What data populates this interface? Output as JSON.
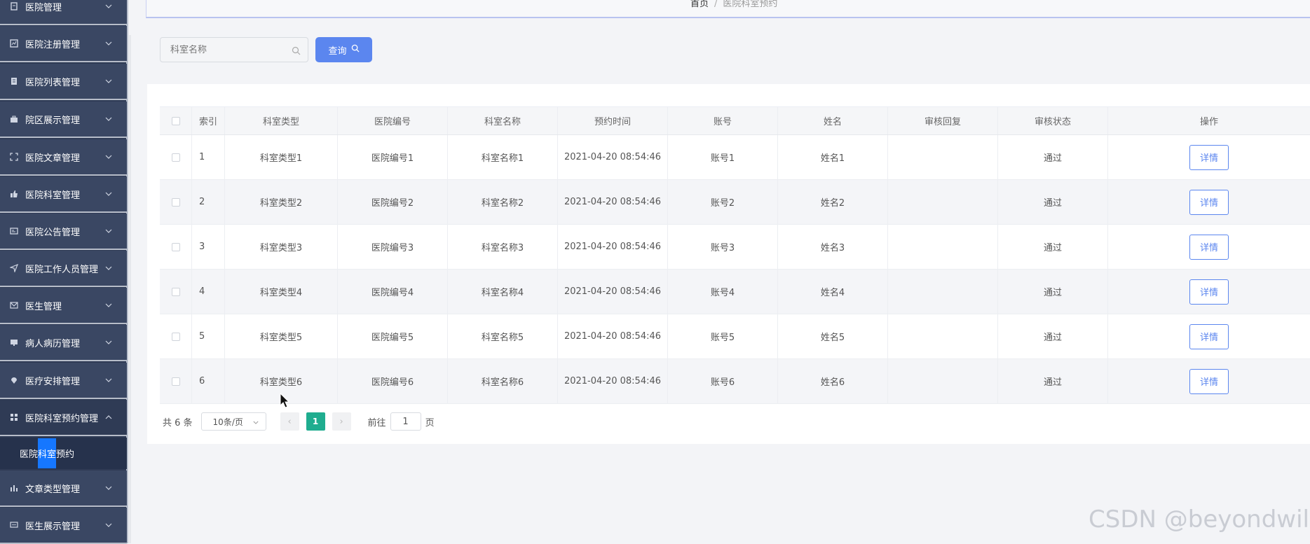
{
  "sidebar": {
    "items": [
      {
        "label": "医院管理",
        "icon": "badge-icon"
      },
      {
        "label": "医院注册管理",
        "icon": "chart-icon"
      },
      {
        "label": "医院列表管理",
        "icon": "clipboard-icon"
      },
      {
        "label": "院区展示管理",
        "icon": "briefcase-icon"
      },
      {
        "label": "医院文章管理",
        "icon": "fullscreen-icon"
      },
      {
        "label": "医院科室管理",
        "icon": "thumb-icon"
      },
      {
        "label": "医院公告管理",
        "icon": "notice-icon"
      },
      {
        "label": "医院工作人员管理",
        "icon": "send-icon"
      },
      {
        "label": "医生管理",
        "icon": "mail-icon"
      },
      {
        "label": "病人病历管理",
        "icon": "monitor-icon"
      },
      {
        "label": "医疗安排管理",
        "icon": "location-icon"
      },
      {
        "label": "医院科室预约管理",
        "icon": "grid-icon"
      },
      {
        "label": "文章类型管理",
        "icon": "bar-chart-icon"
      },
      {
        "label": "医生展示管理",
        "icon": "chat-icon"
      }
    ],
    "submenu": {
      "label": "医院科室预约"
    }
  },
  "breadcrumb": {
    "home": "首页",
    "sep": "/",
    "current": "医院科室预约"
  },
  "search": {
    "placeholder": "科室名称",
    "button": "查询"
  },
  "table": {
    "headers": [
      "索引",
      "科室类型",
      "医院编号",
      "科室名称",
      "预约时间",
      "账号",
      "姓名",
      "审核回复",
      "审核状态",
      "操作"
    ],
    "rows": [
      {
        "idx": "1",
        "type": "科室类型1",
        "hospital_no": "医院编号1",
        "dept": "科室名称1",
        "time": "2021-04-20 08:54:46",
        "account": "账号1",
        "name": "姓名1",
        "reply": "",
        "status": "通过",
        "action": "详情"
      },
      {
        "idx": "2",
        "type": "科室类型2",
        "hospital_no": "医院编号2",
        "dept": "科室名称2",
        "time": "2021-04-20 08:54:46",
        "account": "账号2",
        "name": "姓名2",
        "reply": "",
        "status": "通过",
        "action": "详情"
      },
      {
        "idx": "3",
        "type": "科室类型3",
        "hospital_no": "医院编号3",
        "dept": "科室名称3",
        "time": "2021-04-20 08:54:46",
        "account": "账号3",
        "name": "姓名3",
        "reply": "",
        "status": "通过",
        "action": "详情"
      },
      {
        "idx": "4",
        "type": "科室类型4",
        "hospital_no": "医院编号4",
        "dept": "科室名称4",
        "time": "2021-04-20 08:54:46",
        "account": "账号4",
        "name": "姓名4",
        "reply": "",
        "status": "通过",
        "action": "详情"
      },
      {
        "idx": "5",
        "type": "科室类型5",
        "hospital_no": "医院编号5",
        "dept": "科室名称5",
        "time": "2021-04-20 08:54:46",
        "account": "账号5",
        "name": "姓名5",
        "reply": "",
        "status": "通过",
        "action": "详情"
      },
      {
        "idx": "6",
        "type": "科室类型6",
        "hospital_no": "医院编号6",
        "dept": "科室名称6",
        "time": "2021-04-20 08:54:46",
        "account": "账号6",
        "name": "姓名6",
        "reply": "",
        "status": "通过",
        "action": "详情"
      }
    ]
  },
  "pager": {
    "total": "共 6 条",
    "page_size": "10条/页",
    "prev": "‹",
    "current": "1",
    "next": "›",
    "goto_label": "前往",
    "goto_value": "1",
    "page_suffix": "页"
  },
  "watermark": "CSDN @beyondwild",
  "colors": {
    "sidebar": "#3a4763",
    "accent": "#5b86ef",
    "pager_active": "#1fad8f",
    "submenu_highlight": "#1677ff"
  }
}
